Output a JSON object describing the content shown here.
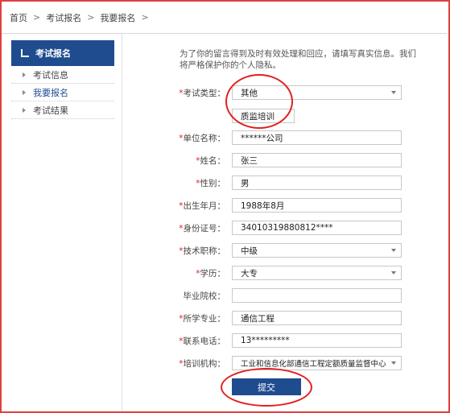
{
  "breadcrumb": {
    "home": "首页",
    "level1": "考试报名",
    "level2": "我要报名",
    "sep": ">"
  },
  "sidebar": {
    "title": "考试报名",
    "items": [
      {
        "label": "考试信息"
      },
      {
        "label": "我要报名"
      },
      {
        "label": "考试结果"
      }
    ]
  },
  "notice": "为了你的留言得到及时有效处理和回应，请填写真实信息。我们将严格保护你的个人隐私。",
  "form": {
    "exam_type": {
      "label": "考试类型：",
      "value": "其他"
    },
    "exam_type_other": {
      "value": "质监培训"
    },
    "company": {
      "label": "单位名称：",
      "value": "******公司"
    },
    "name": {
      "label": "姓名：",
      "value": "张三"
    },
    "gender": {
      "label": "性别：",
      "value": "男"
    },
    "birth": {
      "label": "出生年月：",
      "value": "1988年8月"
    },
    "id_number": {
      "label": "身份证号：",
      "value": "34010319880812****"
    },
    "title": {
      "label": "技术职称：",
      "value": "中级"
    },
    "education": {
      "label": "学历：",
      "value": "大专"
    },
    "school": {
      "label": "毕业院校：",
      "value": ""
    },
    "major": {
      "label": "所学专业：",
      "value": "通信工程"
    },
    "phone": {
      "label": "联系电话：",
      "value": "13*********"
    },
    "institution": {
      "label": "培训机构：",
      "value": "工业和信息化部通信工程定额质量监督中心"
    },
    "required_mark": "*"
  },
  "submit_label": "提交",
  "colors": {
    "accent": "#1f4b8f",
    "annotation": "#e02020"
  }
}
